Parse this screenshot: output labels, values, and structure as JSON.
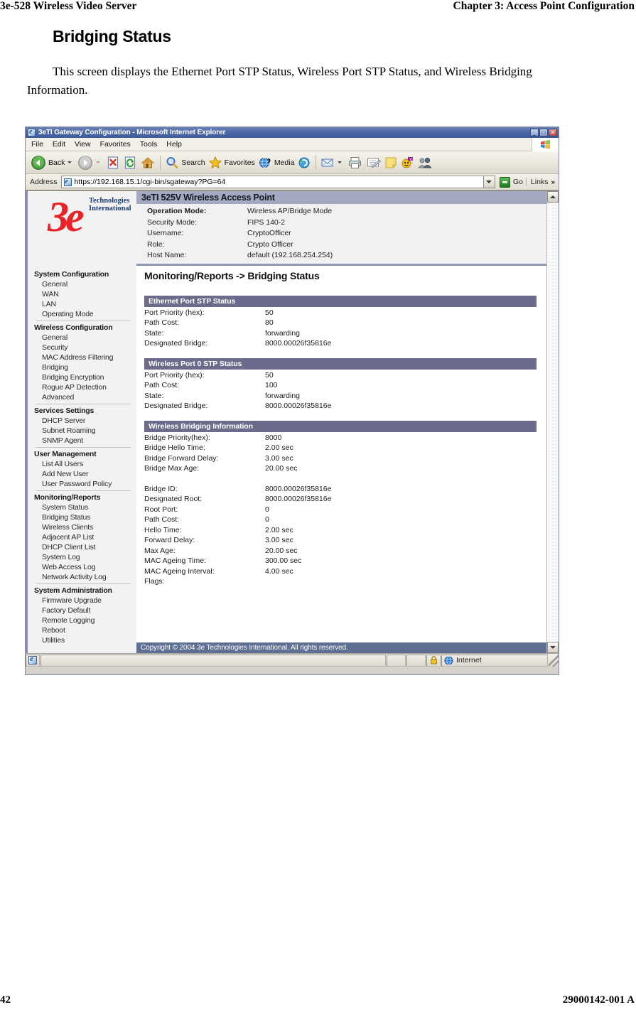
{
  "document": {
    "header_left": "3e-528 Wireless Video Server",
    "header_right": "Chapter 3: Access Point Configuration",
    "title": "Bridging Status",
    "paragraph": "This screen displays the Ethernet Port STP Status, Wireless Port STP Status, and Wireless Bridging Information.",
    "footer_left": "42",
    "footer_right": "29000142-001 A"
  },
  "browser": {
    "window_title": "3eTI Gateway Configuration - Microsoft Internet Explorer",
    "window_buttons": {
      "minimize": "_",
      "maximize": "□",
      "close": "✕"
    },
    "menu": [
      "File",
      "Edit",
      "View",
      "Favorites",
      "Tools",
      "Help"
    ],
    "toolbar": {
      "back": "Back",
      "forward": "",
      "stop": "",
      "refresh": "",
      "home": "",
      "search": "Search",
      "favorites": "Favorites",
      "media": "Media",
      "history": "",
      "mail": "",
      "print": "",
      "edit": "",
      "notes": "",
      "messenger": "",
      "discuss": ""
    },
    "address": {
      "label": "Address",
      "url": "https://192.168.15.1/cgi-bin/sgateway?PG=64",
      "go_label": "Go",
      "links_label": "Links",
      "links_chevron": "»"
    },
    "statusbar": {
      "zone": "Internet"
    }
  },
  "nav": {
    "logo_mark": "3e",
    "logo_line1": "Technologies",
    "logo_line2": "International",
    "groups": [
      {
        "label": "System Configuration",
        "items": [
          "General",
          "WAN",
          "LAN",
          "Operating Mode"
        ]
      },
      {
        "label": "Wireless Configuration",
        "items": [
          "General",
          "Security",
          "MAC Address Filtering",
          "Bridging",
          "Bridging Encryption",
          "Rogue AP Detection",
          "Advanced"
        ]
      },
      {
        "label": "Services Settings",
        "items": [
          "DHCP Server",
          "Subnet Roaming",
          "SNMP Agent"
        ]
      },
      {
        "label": "User Management",
        "items": [
          "List All Users",
          "Add New User",
          "User Password Policy"
        ]
      },
      {
        "label": "Monitoring/Reports",
        "items": [
          "System Status",
          "Bridging Status",
          "Wireless Clients",
          "Adjacent AP List",
          "DHCP Client List",
          "System Log",
          "Web Access Log",
          "Network Activity Log"
        ]
      },
      {
        "label": "System Administration",
        "items": [
          "Firmware Upgrade",
          "Factory Default",
          "Remote Logging",
          "Reboot",
          "Utilities"
        ]
      }
    ]
  },
  "device_header": {
    "title": "3eTI 525V Wireless Access Point",
    "rows": [
      {
        "key": "Operation Mode:",
        "value": "Wireless AP/Bridge Mode"
      },
      {
        "key": "Security Mode:",
        "value": "FIPS 140-2"
      },
      {
        "key": "Username:",
        "value": "CryptoOfficer"
      },
      {
        "key": "Role:",
        "value": "Crypto Officer"
      },
      {
        "key": "Host Name:",
        "value": "default (192.168.254.254)"
      }
    ]
  },
  "page": {
    "breadcrumb": "Monitoring/Reports -> Bridging Status",
    "panels": [
      {
        "title": "Ethernet Port STP Status",
        "rows": [
          {
            "key": "Port Priority (hex):",
            "value": "50"
          },
          {
            "key": "Path Cost:",
            "value": "80"
          },
          {
            "key": "State:",
            "value": "forwarding"
          },
          {
            "key": "Designated Bridge:",
            "value": "8000.00026f35816e"
          }
        ]
      },
      {
        "title": "Wireless Port 0 STP Status",
        "rows": [
          {
            "key": "Port Priority (hex):",
            "value": "50"
          },
          {
            "key": "Path Cost:",
            "value": "100"
          },
          {
            "key": "State:",
            "value": "forwarding"
          },
          {
            "key": "Designated Bridge:",
            "value": "8000.00026f35816e"
          }
        ]
      },
      {
        "title": "Wireless Bridging Information",
        "rows": [
          {
            "key": "Bridge Priority(hex):",
            "value": "8000"
          },
          {
            "key": "Bridge Hello Time:",
            "value": "2.00 sec"
          },
          {
            "key": "Bridge Forward Delay:",
            "value": "3.00 sec"
          },
          {
            "key": "Bridge Max Age:",
            "value": "20.00 sec"
          },
          {
            "key": "",
            "value": ""
          },
          {
            "key": "Bridge ID:",
            "value": "8000.00026f35816e"
          },
          {
            "key": "Designated Root:",
            "value": "8000.00026f35816e"
          },
          {
            "key": "Root Port:",
            "value": "0"
          },
          {
            "key": "Path Cost:",
            "value": "0"
          },
          {
            "key": "Hello Time:",
            "value": "2.00 sec"
          },
          {
            "key": "Forward Delay:",
            "value": "3.00 sec"
          },
          {
            "key": "Max Age:",
            "value": "20.00 sec"
          },
          {
            "key": "MAC Ageing Time:",
            "value": "300.00 sec"
          },
          {
            "key": "MAC Ageing Interval:",
            "value": "4.00 sec"
          },
          {
            "key": "Flags:",
            "value": ""
          }
        ]
      }
    ],
    "copyright": "Copyright © 2004 3e Technologies International. All rights reserved."
  },
  "colors": {
    "panel_header": "#6b6b8b",
    "device_title": "#a3a9c0",
    "copyright_bar": "#5f6f91",
    "logo_red": "#e8232a",
    "logo_blue": "#1c3a73",
    "titlebar_blue": "#3d5a9e"
  }
}
